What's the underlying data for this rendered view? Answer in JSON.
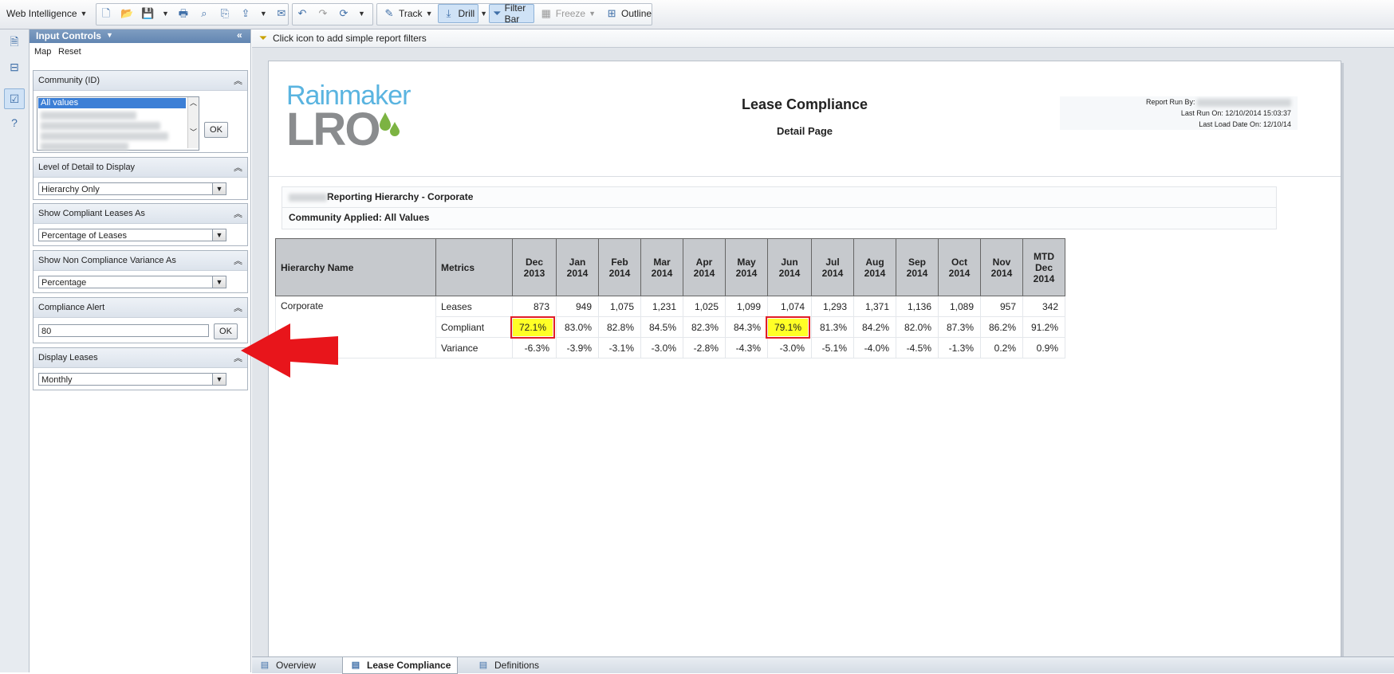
{
  "toolbar": {
    "app_menu": "Web Intelligence",
    "track": "Track",
    "drill": "Drill",
    "filter_bar": "Filter Bar",
    "freeze": "Freeze",
    "outline": "Outline"
  },
  "input_controls": {
    "title": "Input Controls",
    "map": "Map",
    "reset": "Reset",
    "community": {
      "label": "Community (ID)",
      "selected": "All values",
      "ok": "OK"
    },
    "level_of_detail": {
      "label": "Level of Detail to Display",
      "value": "Hierarchy Only"
    },
    "compliant_as": {
      "label": "Show Compliant Leases As",
      "value": "Percentage of Leases"
    },
    "non_compliance_as": {
      "label": "Show Non Compliance Variance As",
      "value": "Percentage"
    },
    "compliance_alert": {
      "label": "Compliance Alert",
      "value": "80",
      "ok": "OK"
    },
    "display_leases": {
      "label": "Display Leases",
      "value": "Monthly"
    }
  },
  "filter_bar": {
    "hint": "Click icon to add simple report filters"
  },
  "report": {
    "logo_top": "Rainmaker",
    "logo_bottom": "LRO",
    "title": "Lease Compliance",
    "subtitle": "Detail Page",
    "run_by_label": "Report Run By:",
    "last_run": "Last Run On: 12/10/2014 15:03:37",
    "last_load": "Last Load Date On: 12/10/14",
    "hierarchy_line": "Reporting Hierarchy - Corporate",
    "community_applied": "Community Applied: All Values"
  },
  "table": {
    "header_hierarchy": "Hierarchy Name",
    "header_metrics": "Metrics",
    "months": [
      [
        "Dec",
        "2013"
      ],
      [
        "Jan",
        "2014"
      ],
      [
        "Feb",
        "2014"
      ],
      [
        "Mar",
        "2014"
      ],
      [
        "Apr",
        "2014"
      ],
      [
        "May",
        "2014"
      ],
      [
        "Jun",
        "2014"
      ],
      [
        "Jul",
        "2014"
      ],
      [
        "Aug",
        "2014"
      ],
      [
        "Sep",
        "2014"
      ],
      [
        "Oct",
        "2014"
      ],
      [
        "Nov",
        "2014"
      ],
      [
        "MTD",
        "Dec",
        "2014"
      ]
    ],
    "hierarchy_name": "Corporate",
    "rows": [
      {
        "metric": "Leases",
        "values": [
          "873",
          "949",
          "1,075",
          "1,231",
          "1,025",
          "1,099",
          "1,074",
          "1,293",
          "1,371",
          "1,136",
          "1,089",
          "957",
          "342"
        ]
      },
      {
        "metric": "Compliant",
        "values": [
          "72.1%",
          "83.0%",
          "82.8%",
          "84.5%",
          "82.3%",
          "84.3%",
          "79.1%",
          "81.3%",
          "84.2%",
          "82.0%",
          "87.3%",
          "86.2%",
          "91.2%"
        ],
        "highlight": [
          0,
          6
        ]
      },
      {
        "metric": "Variance",
        "values": [
          "-6.3%",
          "-3.9%",
          "-3.1%",
          "-3.0%",
          "-2.8%",
          "-4.3%",
          "-3.0%",
          "-5.1%",
          "-4.0%",
          "-4.5%",
          "-1.3%",
          "0.2%",
          "0.9%"
        ]
      }
    ]
  },
  "tabs": {
    "overview": "Overview",
    "lease_compliance": "Lease Compliance",
    "definitions": "Definitions"
  },
  "colors": {
    "alert_highlight": "#ffff26",
    "alert_border": "#e21e26",
    "arrow": "#e8151b",
    "logo_blue": "#5ab4e0",
    "logo_gray": "#8a8c8e",
    "logo_green": "#7cb342"
  }
}
